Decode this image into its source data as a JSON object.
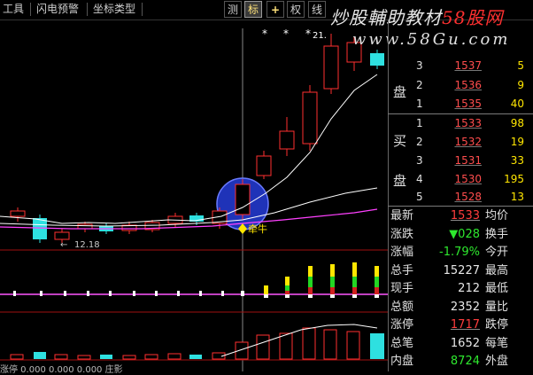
{
  "toolbar": {
    "items": [
      "工具",
      "闪电预警",
      "坐标类型"
    ],
    "tabs": [
      "测",
      "标",
      "+",
      "权",
      "线"
    ],
    "active_tab": "标"
  },
  "watermark": {
    "line1": "炒股輔助教材",
    "line1_red": "58股网",
    "line2": "www.58Gu.com"
  },
  "chart": {
    "high_marker": "21.",
    "low_marker": "12.18",
    "signal_label": "牵牛",
    "markers": [
      "*",
      "*",
      "*"
    ],
    "bottom_text": "涨停  0.000  0.000  0.000    庄影"
  },
  "order_book": {
    "side_labels": [
      "盘",
      "买",
      "盘"
    ],
    "asks": [
      {
        "level": "3",
        "price": "1537",
        "volume": "5"
      },
      {
        "level": "2",
        "price": "1536",
        "volume": "9"
      },
      {
        "level": "1",
        "price": "1535",
        "volume": "40"
      }
    ],
    "bids": [
      {
        "level": "1",
        "price": "1533",
        "volume": "98"
      },
      {
        "level": "2",
        "price": "1532",
        "volume": "19"
      },
      {
        "level": "3",
        "price": "1531",
        "volume": "33"
      },
      {
        "level": "4",
        "price": "1530",
        "volume": "195"
      },
      {
        "level": "5",
        "price": "1528",
        "volume": "13"
      }
    ]
  },
  "quote": {
    "rows": [
      {
        "label": "最新",
        "value": "1533",
        "color": "red",
        "label2": "均价"
      },
      {
        "label": "涨跌",
        "value": "▼028",
        "color": "green",
        "label2": "换手"
      },
      {
        "label": "涨幅",
        "value": "-1.79%",
        "color": "green",
        "label2": "今开"
      },
      {
        "label": "总手",
        "value": "15227",
        "color": "white",
        "label2": "最高"
      },
      {
        "label": "现手",
        "value": "212",
        "color": "white",
        "label2": "最低"
      },
      {
        "label": "总额",
        "value": "2352",
        "color": "white",
        "label2": "量比"
      },
      {
        "label": "涨停",
        "value": "1717",
        "color": "red",
        "label2": "跌停"
      },
      {
        "label": "总笔",
        "value": "1652",
        "color": "white",
        "label2": "每笔"
      },
      {
        "label": "内盘",
        "value": "8724",
        "color": "green",
        "label2": "外盘"
      }
    ]
  },
  "colors": {
    "up": "#ff3030",
    "down": "#2ee0e0",
    "ma_fast": "#ffffff",
    "ma_slow": "#ff40ff",
    "volume_up": "#ffe600",
    "volume_mid": "#23d623",
    "volume_low": "#d02020",
    "highlight_circle": "#2233cc"
  }
}
